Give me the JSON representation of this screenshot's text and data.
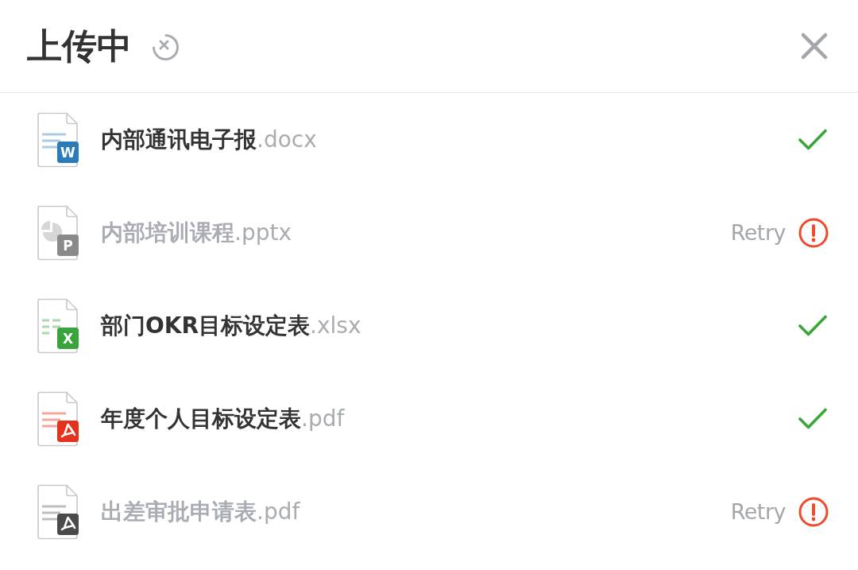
{
  "header": {
    "title": "上传中"
  },
  "files": [
    {
      "name": "内部通讯电子报",
      "extension": ".docx",
      "kind": "word",
      "badge": "W",
      "failed": false
    },
    {
      "name": "内部培训课程",
      "extension": ".pptx",
      "kind": "powerpoint",
      "badge": "P",
      "failed": true,
      "retry": "Retry"
    },
    {
      "name": "部门OKR目标设定表",
      "extension": ".xlsx",
      "kind": "excel",
      "badge": "X",
      "failed": false
    },
    {
      "name": "年度个人目标设定表",
      "extension": ".pdf",
      "kind": "pdf",
      "failed": false
    },
    {
      "name": "出差审批申请表",
      "extension": ".pdf",
      "kind": "pdf",
      "failed": true,
      "retry": "Retry"
    }
  ]
}
